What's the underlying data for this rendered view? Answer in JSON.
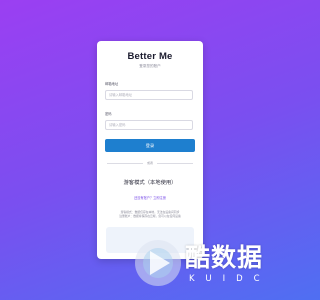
{
  "app": {
    "title": "Better Me",
    "subtitle": "登录您的账户"
  },
  "form": {
    "email_label": "邮箱地址",
    "email_placeholder": "请输入邮箱地址",
    "password_label": "密码",
    "password_placeholder": "请输入密码",
    "login_label": "登录",
    "divider_text": "或者"
  },
  "guest": {
    "label": "游客模式（本地使用）",
    "register_link": "还没有账户？立即注册",
    "note_line1": "游客模式：数据仅存在本地，无法在设备间同步",
    "note_line2": "注册账户：数据将保存在云端，您可以在任何设备"
  },
  "watermark": {
    "text": "酷数据",
    "sub": "KUIDC"
  },
  "colors": {
    "accent": "#1e7fcf",
    "link": "#7b4fe8",
    "background_start": "#9b3ff2",
    "background_end": "#4f6ff2"
  }
}
